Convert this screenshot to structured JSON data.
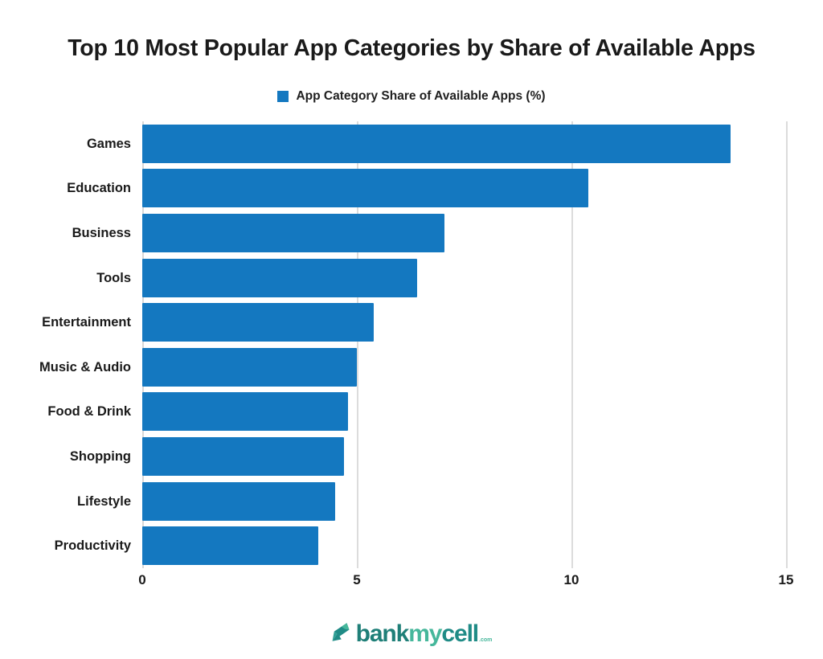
{
  "chart_data": {
    "type": "bar",
    "orientation": "horizontal",
    "title": "Top 10 Most Popular App Categories by Share of Available Apps",
    "subtitle": "",
    "xlabel": "",
    "ylabel": "",
    "legend": {
      "position": "top-center",
      "entries": [
        {
          "label": "App Category Share of Available Apps (%)",
          "color": "#1478c0"
        }
      ]
    },
    "categories": [
      "Games",
      "Education",
      "Business",
      "Tools",
      "Entertainment",
      "Music & Audio",
      "Food & Drink",
      "Shopping",
      "Lifestyle",
      "Productivity"
    ],
    "values": [
      13.7,
      10.4,
      7.05,
      6.4,
      5.4,
      5.0,
      4.8,
      4.7,
      4.5,
      4.1
    ],
    "series": [
      {
        "name": "App Category Share of Available Apps (%)",
        "color": "#1478c0",
        "values": [
          13.7,
          10.4,
          7.05,
          6.4,
          5.4,
          5.0,
          4.8,
          4.7,
          4.5,
          4.1
        ]
      }
    ],
    "xlim": [
      0,
      15
    ],
    "xticks": [
      0,
      5,
      10,
      15
    ],
    "xtick_labels": [
      "0",
      "5",
      "10",
      "15"
    ],
    "grid": "vertical",
    "bar_color": "#1478c0",
    "gridline_color": "#dcdcdc",
    "background_color": "#ffffff"
  },
  "title": {
    "text": "Top 10 Most Popular App Categories by Share of Available Apps"
  },
  "legend": {
    "label": "App Category Share of Available Apps (%)"
  },
  "axis": {
    "x_ticks": [
      "0",
      "5",
      "10",
      "15"
    ],
    "y_categories": [
      "Games",
      "Education",
      "Business",
      "Tools",
      "Entertainment",
      "Music & Audio",
      "Food & Drink",
      "Shopping",
      "Lifestyle",
      "Productivity"
    ]
  },
  "footer": {
    "logo": {
      "part1": "bank",
      "part2": "my",
      "part3": "cell",
      "tld": ".com"
    }
  }
}
